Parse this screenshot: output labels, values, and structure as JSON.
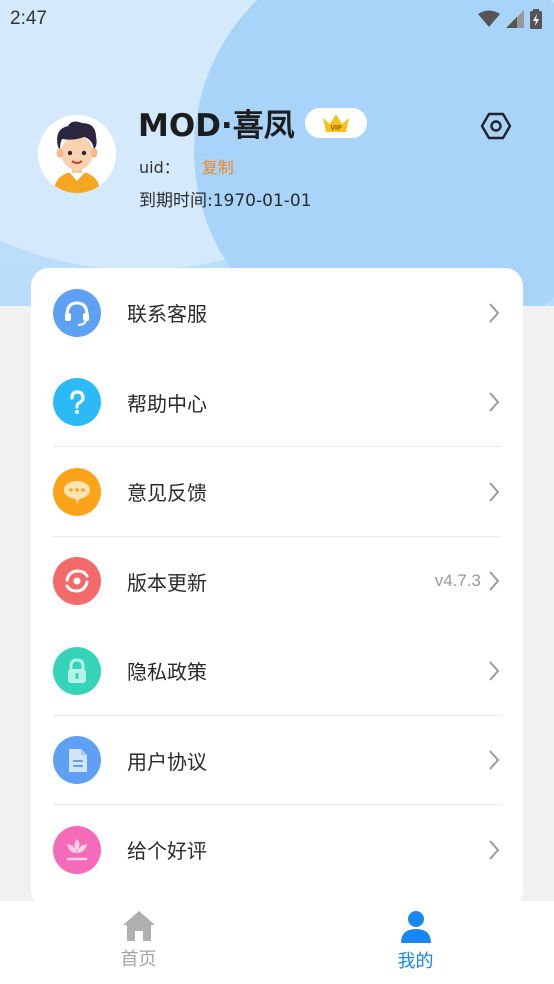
{
  "status_bar": {
    "time": "2:47"
  },
  "profile": {
    "name": "MOD·喜凤",
    "vip_label": "VIP",
    "uid_label": "uid：",
    "copy_label": "复制",
    "expire_text": "到期时间:1970-01-01"
  },
  "menu": {
    "items": [
      {
        "label": "联系客服",
        "icon": "headset-icon",
        "color": "#5ea0f3",
        "extra": ""
      },
      {
        "label": "帮助中心",
        "icon": "question-icon",
        "color": "#2cbaf6",
        "extra": ""
      },
      {
        "label": "意见反馈",
        "icon": "chat-bubble-icon",
        "color": "#fba41a",
        "extra": ""
      },
      {
        "label": "版本更新",
        "icon": "refresh-icon",
        "color": "#f36a6a",
        "extra": "v4.7.3"
      },
      {
        "label": "隐私政策",
        "icon": "lock-icon",
        "color": "#35d3b8",
        "extra": ""
      },
      {
        "label": "用户协议",
        "icon": "document-icon",
        "color": "#5ea0f3",
        "extra": ""
      },
      {
        "label": "给个好评",
        "icon": "flower-icon",
        "color": "#f56ab9",
        "extra": ""
      }
    ]
  },
  "bottom_nav": {
    "home_label": "首页",
    "mine_label": "我的",
    "active_color": "#1a86f0",
    "inactive_color": "#a6a6a6"
  }
}
